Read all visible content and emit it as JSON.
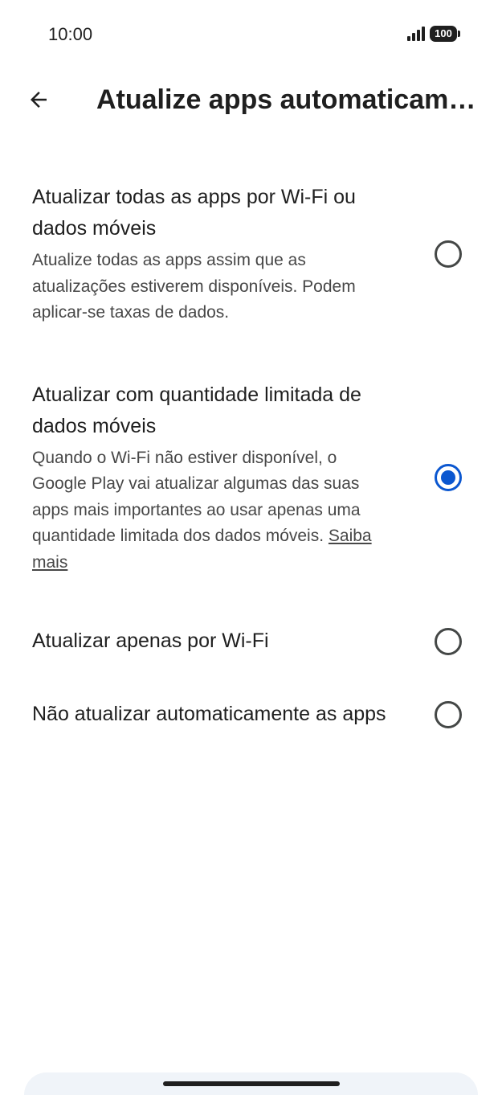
{
  "status_bar": {
    "time": "10:00",
    "battery": "100"
  },
  "app_bar": {
    "title": "Atualize apps automaticamente"
  },
  "options": [
    {
      "title": "Atualizar todas as apps por Wi-Fi ou dados móveis",
      "description": "Atualize todas as apps assim que as atualizações estiverem disponíveis. Podem aplicar-se taxas de dados.",
      "selected": false
    },
    {
      "title": "Atualizar com quantidade limitada de dados móveis",
      "description": "Quando o Wi-Fi não estiver disponível, o Google Play vai atualizar algumas das suas apps mais importantes ao usar apenas uma quantidade limitada dos dados móveis.",
      "link": "Saiba mais",
      "selected": true
    },
    {
      "title": "Atualizar apenas por Wi-Fi",
      "selected": false
    },
    {
      "title": "Não atualizar automaticamente as apps",
      "selected": false
    }
  ],
  "colors": {
    "accent": "#0b57d0",
    "text_primary": "#1f1f1f",
    "text_secondary": "#474747"
  }
}
